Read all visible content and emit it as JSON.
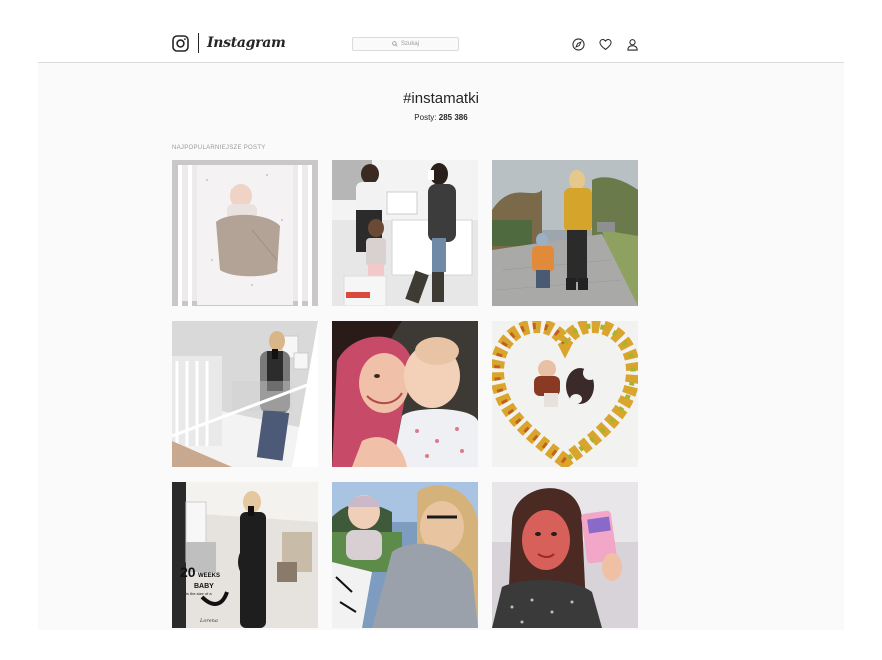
{
  "header": {
    "logo_text": "Instagram",
    "search_placeholder": "Szukaj",
    "icons": [
      "instagram-logo-icon",
      "search-icon",
      "compass-icon",
      "heart-icon",
      "profile-icon"
    ]
  },
  "tag": {
    "name": "#instamatki",
    "posts_label": "Posty:",
    "posts_count": "285 386"
  },
  "section": {
    "label": "NAJPOPULARNIEJSZE POSTY"
  },
  "grid_overlay": {
    "pregnancy_week_number": "20",
    "pregnancy_week_label": "WEEKS",
    "baby_label": "BABY",
    "size_text": "is the size of a",
    "signature": "Lorena"
  },
  "theme": {
    "border": "#dbdbdb",
    "background": "#fafafa",
    "text": "#262626",
    "muted": "#999999"
  }
}
